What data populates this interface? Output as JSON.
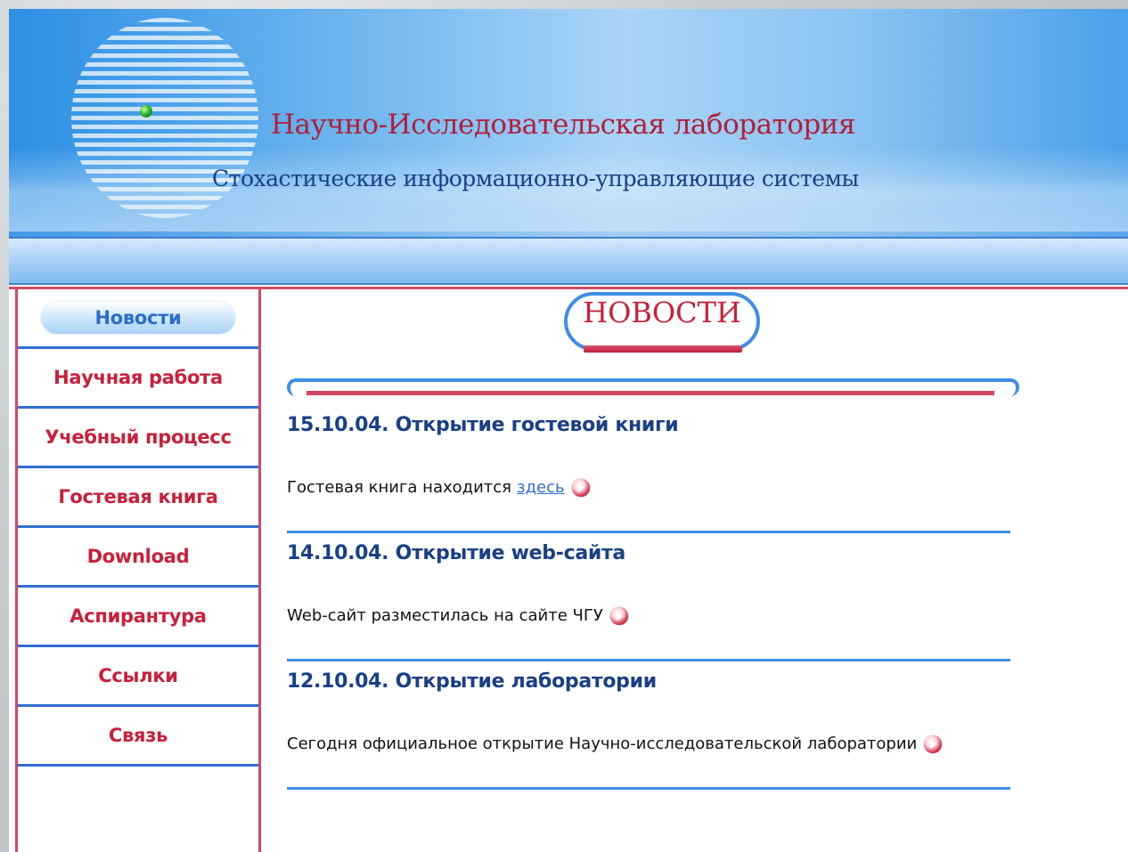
{
  "header": {
    "title": "Научно-Исследовательская лаборатория",
    "subtitle": "Стохастические информационно-управляющие системы"
  },
  "sidebar": {
    "items": [
      {
        "label": "Новости",
        "active": true
      },
      {
        "label": "Научная работа"
      },
      {
        "label": "Учебный процесс"
      },
      {
        "label": "Гостевая книга"
      },
      {
        "label": "Download"
      },
      {
        "label": "Аспирантура"
      },
      {
        "label": "Ссылки"
      },
      {
        "label": "Связь"
      }
    ]
  },
  "main": {
    "section_title": "НОВОСТИ",
    "news": [
      {
        "title": "15.10.04. Открытие гостевой книги",
        "body": "Гостевая книга находится",
        "link": "здесь "
      },
      {
        "title": "14.10.04. Открытие web-сайта",
        "body": "Web-сайт разместилась на сайте ЧГУ"
      },
      {
        "title": "12.10.04. Открытие лаборатории",
        "body": "Сегодня официальное открытие Научно-исследовательской лаборатории"
      }
    ]
  },
  "colors": {
    "accent_red": "#c8203a",
    "accent_blue": "#3f8ee6",
    "title_blue": "#1a3f86"
  }
}
